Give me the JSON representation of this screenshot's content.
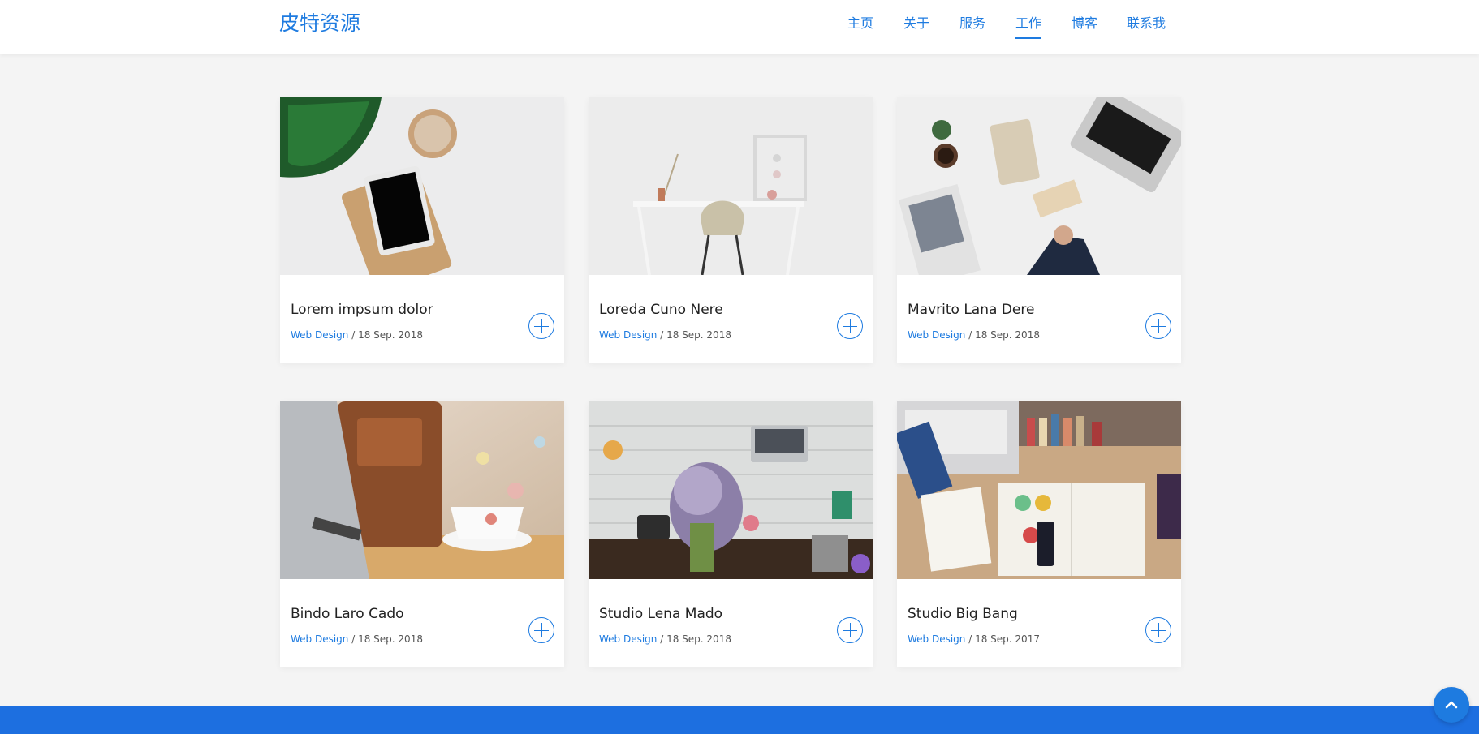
{
  "brand": "皮特资源",
  "nav": [
    {
      "label": "主页",
      "active": false
    },
    {
      "label": "关于",
      "active": false
    },
    {
      "label": "服务",
      "active": false
    },
    {
      "label": "工作",
      "active": true
    },
    {
      "label": "博客",
      "active": false
    },
    {
      "label": "联系我",
      "active": false
    }
  ],
  "cards": [
    {
      "title": "Lorem impsum dolor",
      "category": "Web Design",
      "date": " / 18 Sep. 2018",
      "image": "workspace-tablet-plant-coffee"
    },
    {
      "title": "Loreda Cuno Nere",
      "category": "Web Design",
      "date": " / 18 Sep. 2018",
      "image": "white-desk-chair"
    },
    {
      "title": "Mavrito Lana Dere",
      "category": "Web Design",
      "date": " / 18 Sep. 2018",
      "image": "business-desk-laptop-newspaper"
    },
    {
      "title": "Bindo Laro Cado",
      "category": "Web Design",
      "date": " / 18 Sep. 2018",
      "image": "laptop-bag-coffee-cup"
    },
    {
      "title": "Studio Lena Mado",
      "category": "Web Design",
      "date": " / 18 Sep. 2018",
      "image": "craft-table-flowers-laptop"
    },
    {
      "title": "Studio Big Bang",
      "category": "Web Design",
      "date": " / 18 Sep. 2017",
      "image": "desk-books-notebook-magazines"
    }
  ],
  "colors": {
    "accent": "#1e7be0",
    "footer": "#1d6fe0",
    "background": "#f4f4f4"
  },
  "icons": {
    "card_button": "plus-circle-icon",
    "back_to_top": "chevron-up-icon"
  }
}
